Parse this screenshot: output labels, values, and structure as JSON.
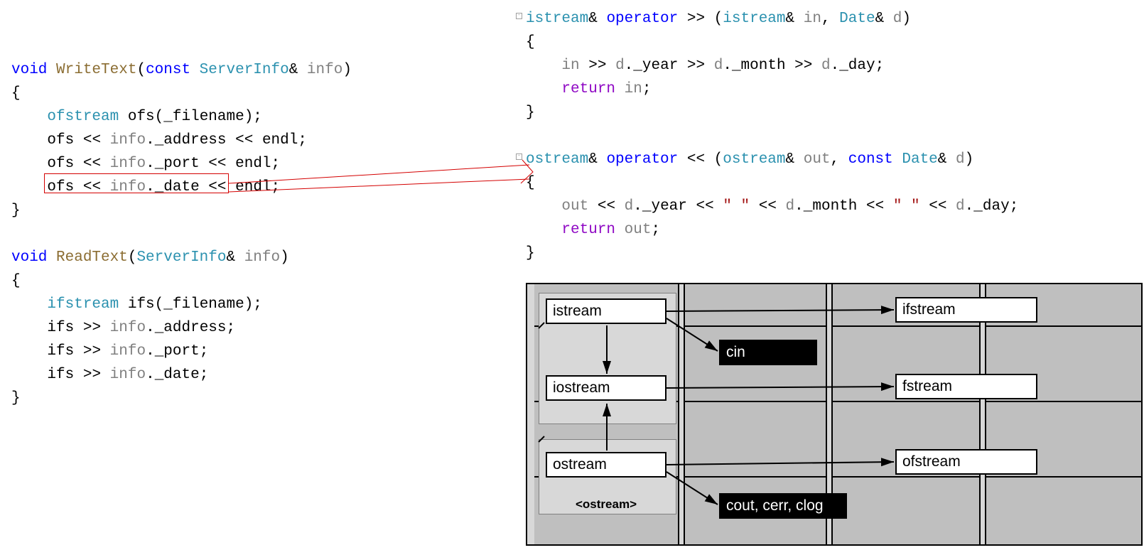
{
  "left": {
    "l0": "void",
    "l0b": " WriteText",
    "l0c": "(",
    "l0d": "const",
    "l0e": " ServerInfo",
    "l0f": "& ",
    "l0g": "info",
    "l0h": ")",
    "l1": "{",
    "l2a": "    ",
    "l2b": "ofstream",
    "l2c": " ofs",
    "l2d": "(",
    "l2e": "_filename",
    "l2f": ");",
    "l3a": "    ",
    "l3b": "ofs",
    "l3c": " << ",
    "l3d": "info",
    "l3e": ".",
    "l3f": "_address",
    "l3g": " << ",
    "l3h": "endl",
    "l3i": ";",
    "l4a": "    ",
    "l4b": "ofs",
    "l4c": " << ",
    "l4d": "info",
    "l4e": ".",
    "l4f": "_port",
    "l4g": " << ",
    "l4h": "endl",
    "l4i": ";",
    "l5a": "    ",
    "l5b": "ofs",
    "l5c": " << ",
    "l5d": "info",
    "l5e": ".",
    "l5f": "_date",
    "l5g": " << ",
    "l5h": "endl",
    "l5i": ";",
    "l6": "}",
    "r0a": "void",
    "r0b": " ReadText",
    "r0c": "(",
    "r0d": "ServerInfo",
    "r0e": "& ",
    "r0f": "info",
    "r0g": ")",
    "r1": "{",
    "r2a": "    ",
    "r2b": "ifstream",
    "r2c": " ifs",
    "r2d": "(",
    "r2e": "_filename",
    "r2f": ");",
    "r3a": "    ",
    "r3b": "ifs",
    "r3c": " >> ",
    "r3d": "info",
    "r3e": ".",
    "r3f": "_address",
    "r3g": ";",
    "r4a": "    ",
    "r4b": "ifs",
    "r4c": " >> ",
    "r4d": "info",
    "r4e": ".",
    "r4f": "_port",
    "r4g": ";",
    "r5a": "    ",
    "r5b": "ifs",
    "r5c": " >> ",
    "r5d": "info",
    "r5e": ".",
    "r5f": "_date",
    "r5g": ";",
    "r6": "}"
  },
  "right": {
    "a0a": "istream",
    "a0b": "& ",
    "a0c": "operator",
    "a0d": " >> (",
    "a0e": "istream",
    "a0f": "& ",
    "a0g": "in",
    "a0h": ", ",
    "a0i": "Date",
    "a0j": "& ",
    "a0k": "d",
    "a0l": ")",
    "a1": "{",
    "a2a": "    ",
    "a2b": "in",
    "a2c": " >> ",
    "a2d": "d",
    "a2e": ".",
    "a2f": "_year",
    "a2g": " >> ",
    "a2h": "d",
    "a2i": ".",
    "a2j": "_month",
    "a2k": " >> ",
    "a2l": "d",
    "a2m": ".",
    "a2n": "_day",
    "a2o": ";",
    "a3a": "    ",
    "a3b": "return",
    "a3c": " ",
    "a3d": "in",
    "a3e": ";",
    "a4": "}",
    "b0a": "ostream",
    "b0b": "& ",
    "b0c": "operator",
    "b0d": " << (",
    "b0e": "ostream",
    "b0f": "& ",
    "b0g": "out",
    "b0h": ", ",
    "b0i": "const",
    "b0j": " Date",
    "b0k": "& ",
    "b0l": "d",
    "b0m": ")",
    "b1": "{",
    "b2a": "    ",
    "b2b": "out",
    "b2c": " << ",
    "b2d": "d",
    "b2e": ".",
    "b2f": "_year",
    "b2g": " << ",
    "b2h": "\" \"",
    "b2i": " << ",
    "b2j": "d",
    "b2k": ".",
    "b2l": "_month",
    "b2m": " << ",
    "b2n": "\" \"",
    "b2o": " << ",
    "b2p": "d",
    "b2q": ".",
    "b2r": "_day",
    "b2s": ";",
    "b3a": "    ",
    "b3b": "return",
    "b3c": " ",
    "b3d": "out",
    "b3e": ";",
    "b4": "}"
  },
  "diagram": {
    "istream": "istream",
    "cin": "cin",
    "iostream": "iostream",
    "ostream": "ostream",
    "ostream_label": "<ostream>",
    "cout": "cout, cerr, clog",
    "ifstream": "ifstream",
    "fstream": "fstream",
    "ofstream": "ofstream"
  }
}
